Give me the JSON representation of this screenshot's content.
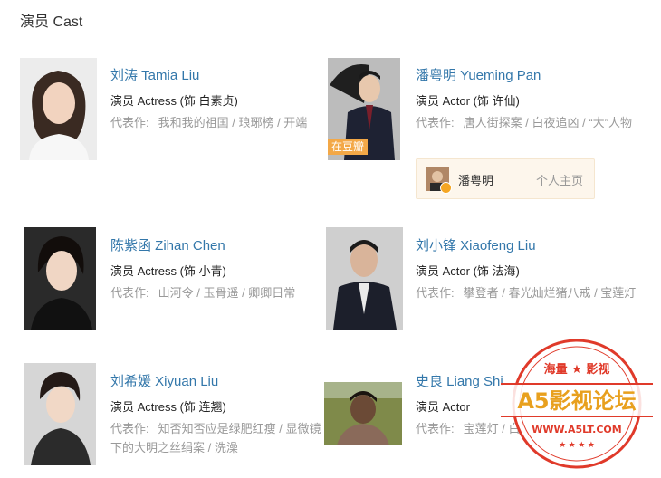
{
  "section": {
    "title": "演员 Cast"
  },
  "cast": [
    {
      "name": "刘涛 Tamia Liu",
      "role": "演员 Actress (饰 白素贞)",
      "works_label": "代表作:",
      "works": "我和我的祖国 / 琅琊榜 / 开端"
    },
    {
      "name": "潘粤明 Yueming Pan",
      "role": "演员 Actor (饰 许仙)",
      "works_label": "代表作:",
      "works": "唐人街探案 / 白夜追凶 / “大”人物",
      "badge": "在豆瓣",
      "homepage": {
        "user": "潘粤明",
        "link": "个人主页"
      }
    },
    {
      "name": "陈紫函 Zihan Chen",
      "role": "演员 Actress (饰 小青)",
      "works_label": "代表作:",
      "works": "山河令 / 玉骨遥 / 卿卿日常"
    },
    {
      "name": "刘小锋 Xiaofeng Liu",
      "role": "演员 Actor (饰 法海)",
      "works_label": "代表作:",
      "works": "攀登者 / 春光灿烂猪八戒 / 宝莲灯"
    },
    {
      "name": "刘希媛 Xiyuan Liu",
      "role": "演员 Actress (饰 连翘)",
      "works_label": "代表作:",
      "works": "知否知否应是绿肥红瘦 / 显微镜下的大明之丝绢案 / 洗澡"
    },
    {
      "name": "史良 Liang Shi",
      "role": "演员 Actor",
      "works_label": "代表作:",
      "works": "宝莲灯 / 白"
    }
  ],
  "watermark": {
    "top": "海量 ★ 影视",
    "main": "A5影视论坛",
    "url": "WWW.A5LT.COM",
    "color": "#e03a2a"
  }
}
